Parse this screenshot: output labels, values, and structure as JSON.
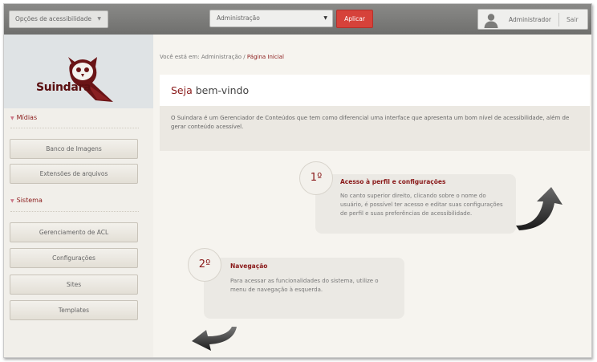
{
  "topbar": {
    "accessibility_select": "Opções de acessibilidade",
    "admin_select": "Administração",
    "apply_label": "Aplicar",
    "user_name": "Administrador",
    "logout_label": "Sair"
  },
  "sidebar": {
    "logo_text": "Suindara",
    "sections": [
      {
        "title": "Mídias",
        "items": [
          "Banco de Imagens",
          "Extensões de arquivos"
        ]
      },
      {
        "title": "Sistema",
        "items": [
          "Gerenciamento de ACL",
          "Configurações",
          "Sites",
          "Templates"
        ]
      }
    ]
  },
  "breadcrumb": {
    "prefix": "Você está em: Administração / ",
    "current": "Página Inicial"
  },
  "welcome": {
    "brand": "Seja",
    "title_rest": " bem-vindo",
    "body": "O Suindara é um Gerenciador de Conteúdos que tem como diferencial uma interface que apresenta um bom nível de acessibilidade, além de gerar conteúdo acessível."
  },
  "steps": [
    {
      "number": "1º",
      "title": "Acesso à perfil e configurações",
      "text": "No canto superior direito, clicando sobre o nome do usuário, é possível ter acesso e editar suas configurações de perfil e suas preferências de acessibilidade."
    },
    {
      "number": "2º",
      "title": "Navegação",
      "text": "Para acessar as funcionalidades do sistema, utilize o menu de navegação à esquerda."
    }
  ],
  "colors": {
    "accent": "#d6423a",
    "brand": "#8a1a1a"
  }
}
